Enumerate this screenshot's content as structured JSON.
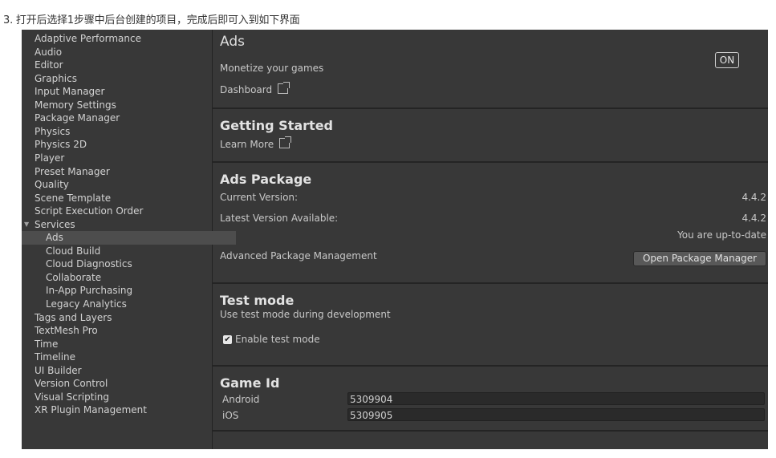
{
  "caption": "3. 打开后选择1步骤中后台创建的项目，完成后即可入到如下界面",
  "sidebar": {
    "items": [
      {
        "label": "Adaptive Performance",
        "level": 0
      },
      {
        "label": "Audio",
        "level": 0
      },
      {
        "label": "Editor",
        "level": 0
      },
      {
        "label": "Graphics",
        "level": 0
      },
      {
        "label": "Input Manager",
        "level": 0
      },
      {
        "label": "Memory Settings",
        "level": 0
      },
      {
        "label": "Package Manager",
        "level": 0
      },
      {
        "label": "Physics",
        "level": 0
      },
      {
        "label": "Physics 2D",
        "level": 0
      },
      {
        "label": "Player",
        "level": 0
      },
      {
        "label": "Preset Manager",
        "level": 0
      },
      {
        "label": "Quality",
        "level": 0
      },
      {
        "label": "Scene Template",
        "level": 0
      },
      {
        "label": "Script Execution Order",
        "level": 0
      },
      {
        "label": "Services",
        "level": 0,
        "expanded": true
      },
      {
        "label": "Ads",
        "level": 1,
        "selected": true
      },
      {
        "label": "Cloud Build",
        "level": 1
      },
      {
        "label": "Cloud Diagnostics",
        "level": 1
      },
      {
        "label": "Collaborate",
        "level": 1
      },
      {
        "label": "In-App Purchasing",
        "level": 1
      },
      {
        "label": "Legacy Analytics",
        "level": 1
      },
      {
        "label": "Tags and Layers",
        "level": 0
      },
      {
        "label": "TextMesh Pro",
        "level": 0
      },
      {
        "label": "Time",
        "level": 0
      },
      {
        "label": "Timeline",
        "level": 0
      },
      {
        "label": "UI Builder",
        "level": 0
      },
      {
        "label": "Version Control",
        "level": 0
      },
      {
        "label": "Visual Scripting",
        "level": 0
      },
      {
        "label": "XR Plugin Management",
        "level": 0
      }
    ]
  },
  "ads": {
    "title": "Ads",
    "subtitle": "Monetize your games",
    "dashboard_label": "Dashboard",
    "toggle_label": "ON"
  },
  "getting_started": {
    "title": "Getting Started",
    "learn_more_label": "Learn More"
  },
  "ads_package": {
    "title": "Ads Package",
    "current_version_label": "Current Version:",
    "current_version_value": "4.4.2",
    "latest_version_label": "Latest Version Available:",
    "latest_version_value": "4.4.2",
    "status_text": "You are up-to-date",
    "advanced_label": "Advanced Package Management",
    "open_pm_button": "Open Package Manager"
  },
  "test_mode": {
    "title": "Test mode",
    "description": "Use test mode during development",
    "checkbox_label": "Enable test mode",
    "checkbox_checked": true
  },
  "game_id": {
    "title": "Game Id",
    "android_label": "Android",
    "android_value": "5309904",
    "ios_label": "iOS",
    "ios_value": "5309905"
  },
  "colors": {
    "panel_bg": "#383838",
    "selected_bg": "#4d4d4d",
    "text": "#d2d2d2"
  }
}
